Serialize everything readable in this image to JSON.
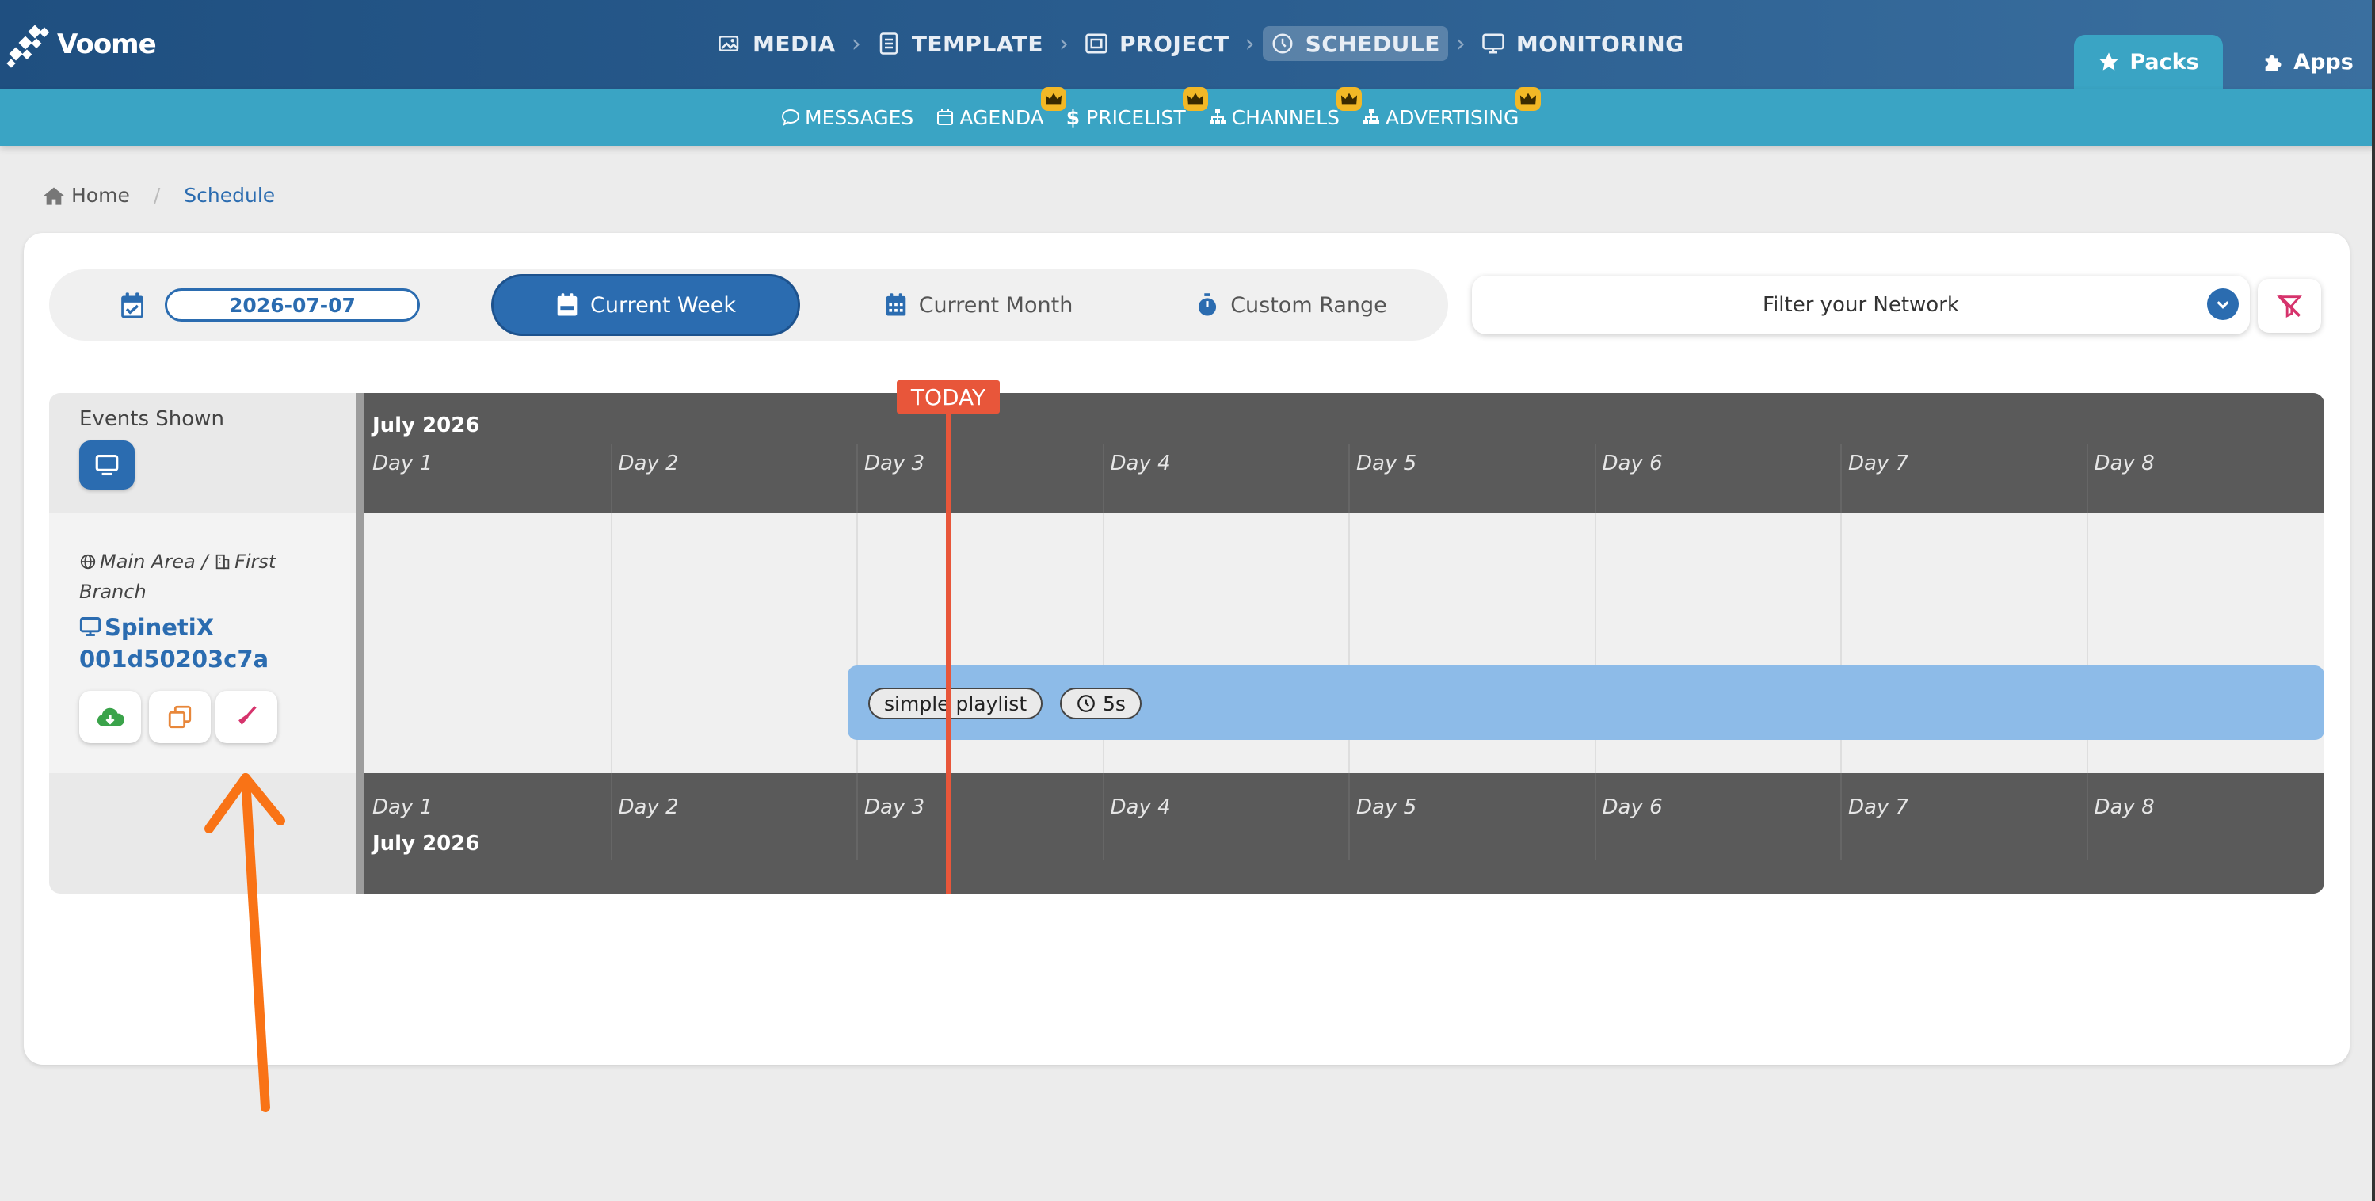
{
  "app": {
    "name": "Voome"
  },
  "main_nav": {
    "items": [
      {
        "label": "MEDIA",
        "icon": "image-icon"
      },
      {
        "label": "TEMPLATE",
        "icon": "template-icon"
      },
      {
        "label": "PROJECT",
        "icon": "project-icon"
      },
      {
        "label": "SCHEDULE",
        "icon": "clock-icon",
        "active": true
      },
      {
        "label": "MONITORING",
        "icon": "monitor-icon"
      }
    ]
  },
  "tabs": {
    "packs": "Packs",
    "apps": "Apps"
  },
  "sub_nav": {
    "items": [
      {
        "label": "MESSAGES",
        "icon": "chat-icon",
        "premium": false
      },
      {
        "label": "AGENDA",
        "icon": "calendar-icon",
        "premium": true
      },
      {
        "label": "PRICELIST",
        "icon": "dollar-icon",
        "premium": true
      },
      {
        "label": "CHANNELS",
        "icon": "sitemap-icon",
        "premium": true
      },
      {
        "label": "ADVERTISING",
        "icon": "sitemap-icon",
        "premium": true
      }
    ]
  },
  "breadcrumb": {
    "home": "Home",
    "current": "Schedule"
  },
  "range": {
    "date": "2026-07-07",
    "current_week": "Current Week",
    "current_month": "Current Month",
    "custom_range": "Custom Range"
  },
  "network_filter": {
    "label": "Filter your Network"
  },
  "timeline": {
    "events_shown": "Events Shown",
    "month": "July 2026",
    "days": [
      "Day 1",
      "Day 2",
      "Day 3",
      "Day 4",
      "Day 5",
      "Day 6",
      "Day 7",
      "Day 8"
    ],
    "today_label": "TODAY",
    "location": {
      "area": "Main Area",
      "separator": "/",
      "branch": "First Branch"
    },
    "device": {
      "name": "SpinetiX 001d50203c7a"
    },
    "event": {
      "name": "simple playlist",
      "duration": "5s"
    }
  },
  "colors": {
    "nav_dark": "#1f4f80",
    "sub_nav": "#3aa4c4",
    "accent": "#2b6cb0",
    "header_gray": "#5a5a5a",
    "event_bar": "#8dbbe8",
    "today": "#e8563a",
    "crown": "#f2b826",
    "arrow": "#f97316"
  }
}
